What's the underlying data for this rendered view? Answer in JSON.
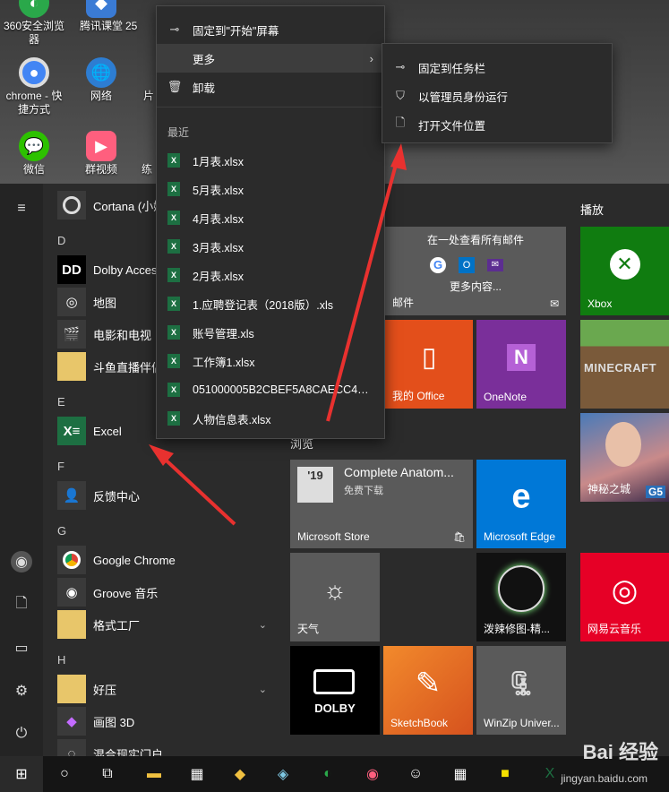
{
  "desktop": {
    "icons": [
      {
        "label": "360安全浏览\n器",
        "icon": "browser-360-icon",
        "color": "#2aa84a"
      },
      {
        "label": "腾讯课堂",
        "icon": "tencent-classroom-icon",
        "color": "#3a7bd5"
      },
      {
        "label": "25",
        "icon": "file-icon",
        "color": "#666666"
      },
      {
        "label": "chrome - 快\n捷方式",
        "icon": "chrome-icon",
        "color": "#4285f4"
      },
      {
        "label": "网络",
        "icon": "network-icon",
        "color": "#2d7dd2"
      },
      {
        "label": "片",
        "icon": "folder-icon",
        "color": "#d9a400"
      },
      {
        "label": "微信",
        "icon": "wechat-icon",
        "color": "#2dc100"
      },
      {
        "label": "群视频",
        "icon": "group-video-icon",
        "color": "#ff5f7e"
      },
      {
        "label": "练",
        "icon": "app-icon",
        "color": "#3a7bd5"
      }
    ]
  },
  "applist": {
    "items": [
      {
        "type": "app",
        "label": "Cortana (小娜)",
        "icon": "cortana-icon",
        "bg": "#3a3a3a"
      },
      {
        "type": "letter",
        "label": "D"
      },
      {
        "type": "app",
        "label": "Dolby Access",
        "icon": "dolby-icon",
        "bg": "#000000"
      },
      {
        "type": "app",
        "label": "地图",
        "icon": "maps-icon",
        "bg": "#3a3a3a"
      },
      {
        "type": "app",
        "label": "电影和电视",
        "icon": "movies-icon",
        "bg": "#3a3a3a"
      },
      {
        "type": "app",
        "label": "斗鱼直播伴侣",
        "icon": "folder-icon",
        "bg": "#e8c66a",
        "chevron": false
      },
      {
        "type": "letter",
        "label": "E"
      },
      {
        "type": "app",
        "label": "Excel",
        "icon": "excel-icon",
        "bg": "#1d6f42"
      },
      {
        "type": "letter",
        "label": "F"
      },
      {
        "type": "app",
        "label": "反馈中心",
        "icon": "feedback-icon",
        "bg": "#3a3a3a"
      },
      {
        "type": "letter",
        "label": "G"
      },
      {
        "type": "app",
        "label": "Google Chrome",
        "icon": "chrome-icon",
        "bg": "#3a3a3a"
      },
      {
        "type": "app",
        "label": "Groove 音乐",
        "icon": "groove-icon",
        "bg": "#3a3a3a"
      },
      {
        "type": "app",
        "label": "格式工厂",
        "icon": "folder-icon",
        "bg": "#e8c66a",
        "chevron": true
      },
      {
        "type": "letter",
        "label": "H"
      },
      {
        "type": "app",
        "label": "好压",
        "icon": "folder-icon",
        "bg": "#e8c66a",
        "chevron": true
      },
      {
        "type": "app",
        "label": "画图 3D",
        "icon": "paint3d-icon",
        "bg": "#3a3a3a"
      },
      {
        "type": "app",
        "label": "混合现实门户",
        "icon": "mixed-reality-icon",
        "bg": "#3a3a3a"
      }
    ]
  },
  "tiles": {
    "group_browse": "浏览",
    "group_play": "播放",
    "mail_title": "在一处查看所有邮件",
    "mail_more": "更多内容...",
    "mail_name": "邮件",
    "office_name": "我的 Office",
    "onenote_name": "OneNote",
    "xbox_name": "Xbox",
    "minecraft_name": "MINECRAFT",
    "store_app_title": "Complete Anatom...",
    "store_app_sub": "免费下载",
    "store_badge": "'19",
    "store_name": "Microsoft Store",
    "edge_name": "Microsoft Edge",
    "weather_name": "天气",
    "pomo_name": "泼辣修图-精...",
    "netease_name": "网易云音乐",
    "dolby_name": "DOLBY",
    "sketch_name": "SketchBook",
    "winzip_name": "WinZip Univer...",
    "g5_badge": "G5",
    "game_name": "神秘之城"
  },
  "context_menu": {
    "pin_start": "固定到\"开始\"屏幕",
    "more": "更多",
    "uninstall": "卸载",
    "recent_header": "最近",
    "recent": [
      "1月表.xlsx",
      "5月表.xlsx",
      "4月表.xlsx",
      "3月表.xlsx",
      "2月表.xlsx",
      "1.应聘登记表（2018版）.xls",
      "账号管理.xls",
      "工作簿1.xlsx",
      "051000005B2CBEF5A8CAECC45007...",
      "人物信息表.xlsx"
    ]
  },
  "submenu": {
    "pin_taskbar": "固定到任务栏",
    "run_admin": "以管理员身份运行",
    "open_location": "打开文件位置"
  },
  "watermark": {
    "main": "Bai 经验",
    "sub": "jingyan.baidu.com"
  }
}
